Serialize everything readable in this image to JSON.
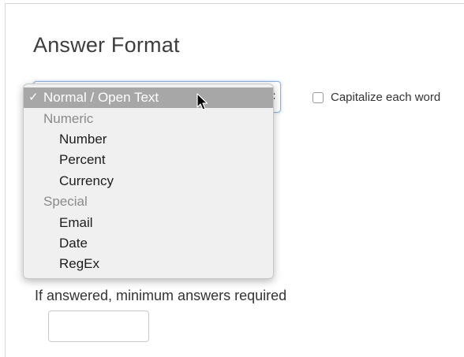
{
  "section": {
    "title": "Answer Format"
  },
  "answer_format_select": {
    "selected_value": "Normal / Open Text",
    "options": [
      {
        "label": "Normal / Open Text",
        "type": "option",
        "selected": true,
        "check": "✓"
      },
      {
        "label": "Numeric",
        "type": "group"
      },
      {
        "label": "Number",
        "type": "option"
      },
      {
        "label": "Percent",
        "type": "option"
      },
      {
        "label": "Currency",
        "type": "option"
      },
      {
        "label": "Special",
        "type": "group"
      },
      {
        "label": "Email",
        "type": "option"
      },
      {
        "label": "Date",
        "type": "option"
      },
      {
        "label": "RegEx",
        "type": "option"
      }
    ]
  },
  "capitalize_checkbox": {
    "label": "Capitalize each word",
    "checked": false
  },
  "minimum_answers": {
    "label": "If answered, minimum answers required",
    "value": ""
  },
  "colors": {
    "selected_option_bg": "#a7a7a7",
    "group_label": "#8a8a8a",
    "focus_border": "#8fb3dd"
  },
  "icons": {
    "cursor": "mouse-pointer-icon",
    "select_arrows": "up-down-arrows-icon",
    "check": "checkmark-icon"
  }
}
